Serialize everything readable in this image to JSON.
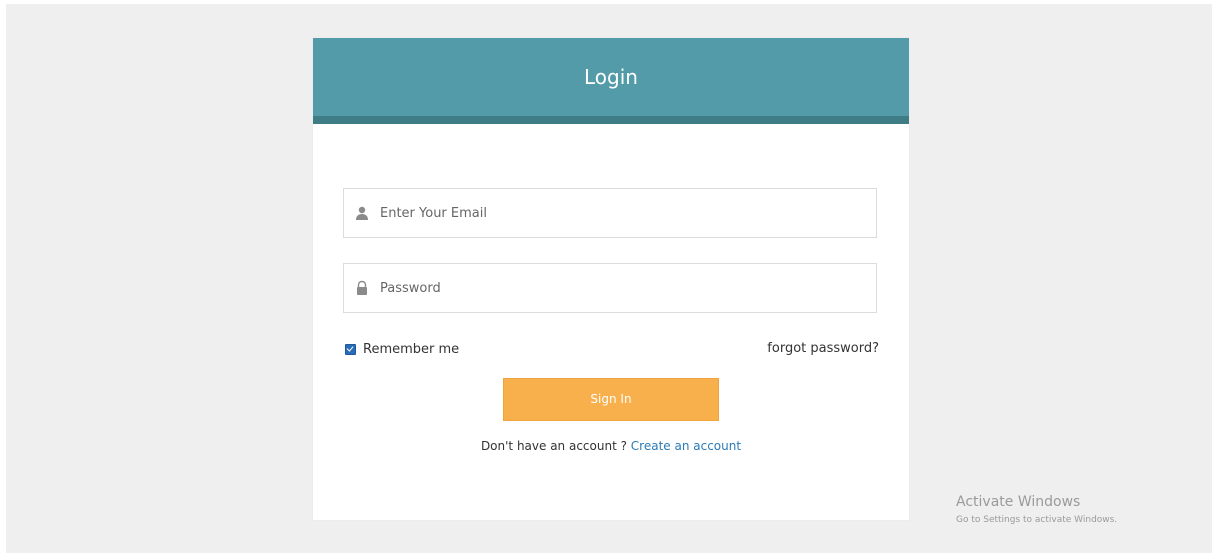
{
  "login": {
    "title": "Login",
    "email": {
      "placeholder": "Enter Your Email",
      "icon": "user-icon"
    },
    "password": {
      "placeholder": "Password",
      "icon": "lock-icon"
    },
    "remember_label": "Remember me",
    "remember_checked": true,
    "forgot_label": "forgot password?",
    "signin_label": "Sign In",
    "signup_prompt": "Don't have an account ?",
    "signup_link": "Create an account"
  },
  "watermark": {
    "title": "Activate Windows",
    "subtitle": "Go to Settings to activate Windows."
  },
  "colors": {
    "header": "#539ba8",
    "header_border": "#3f7d86",
    "button": "#f7b04c",
    "link": "#2b7ab7",
    "background": "#efefef"
  }
}
